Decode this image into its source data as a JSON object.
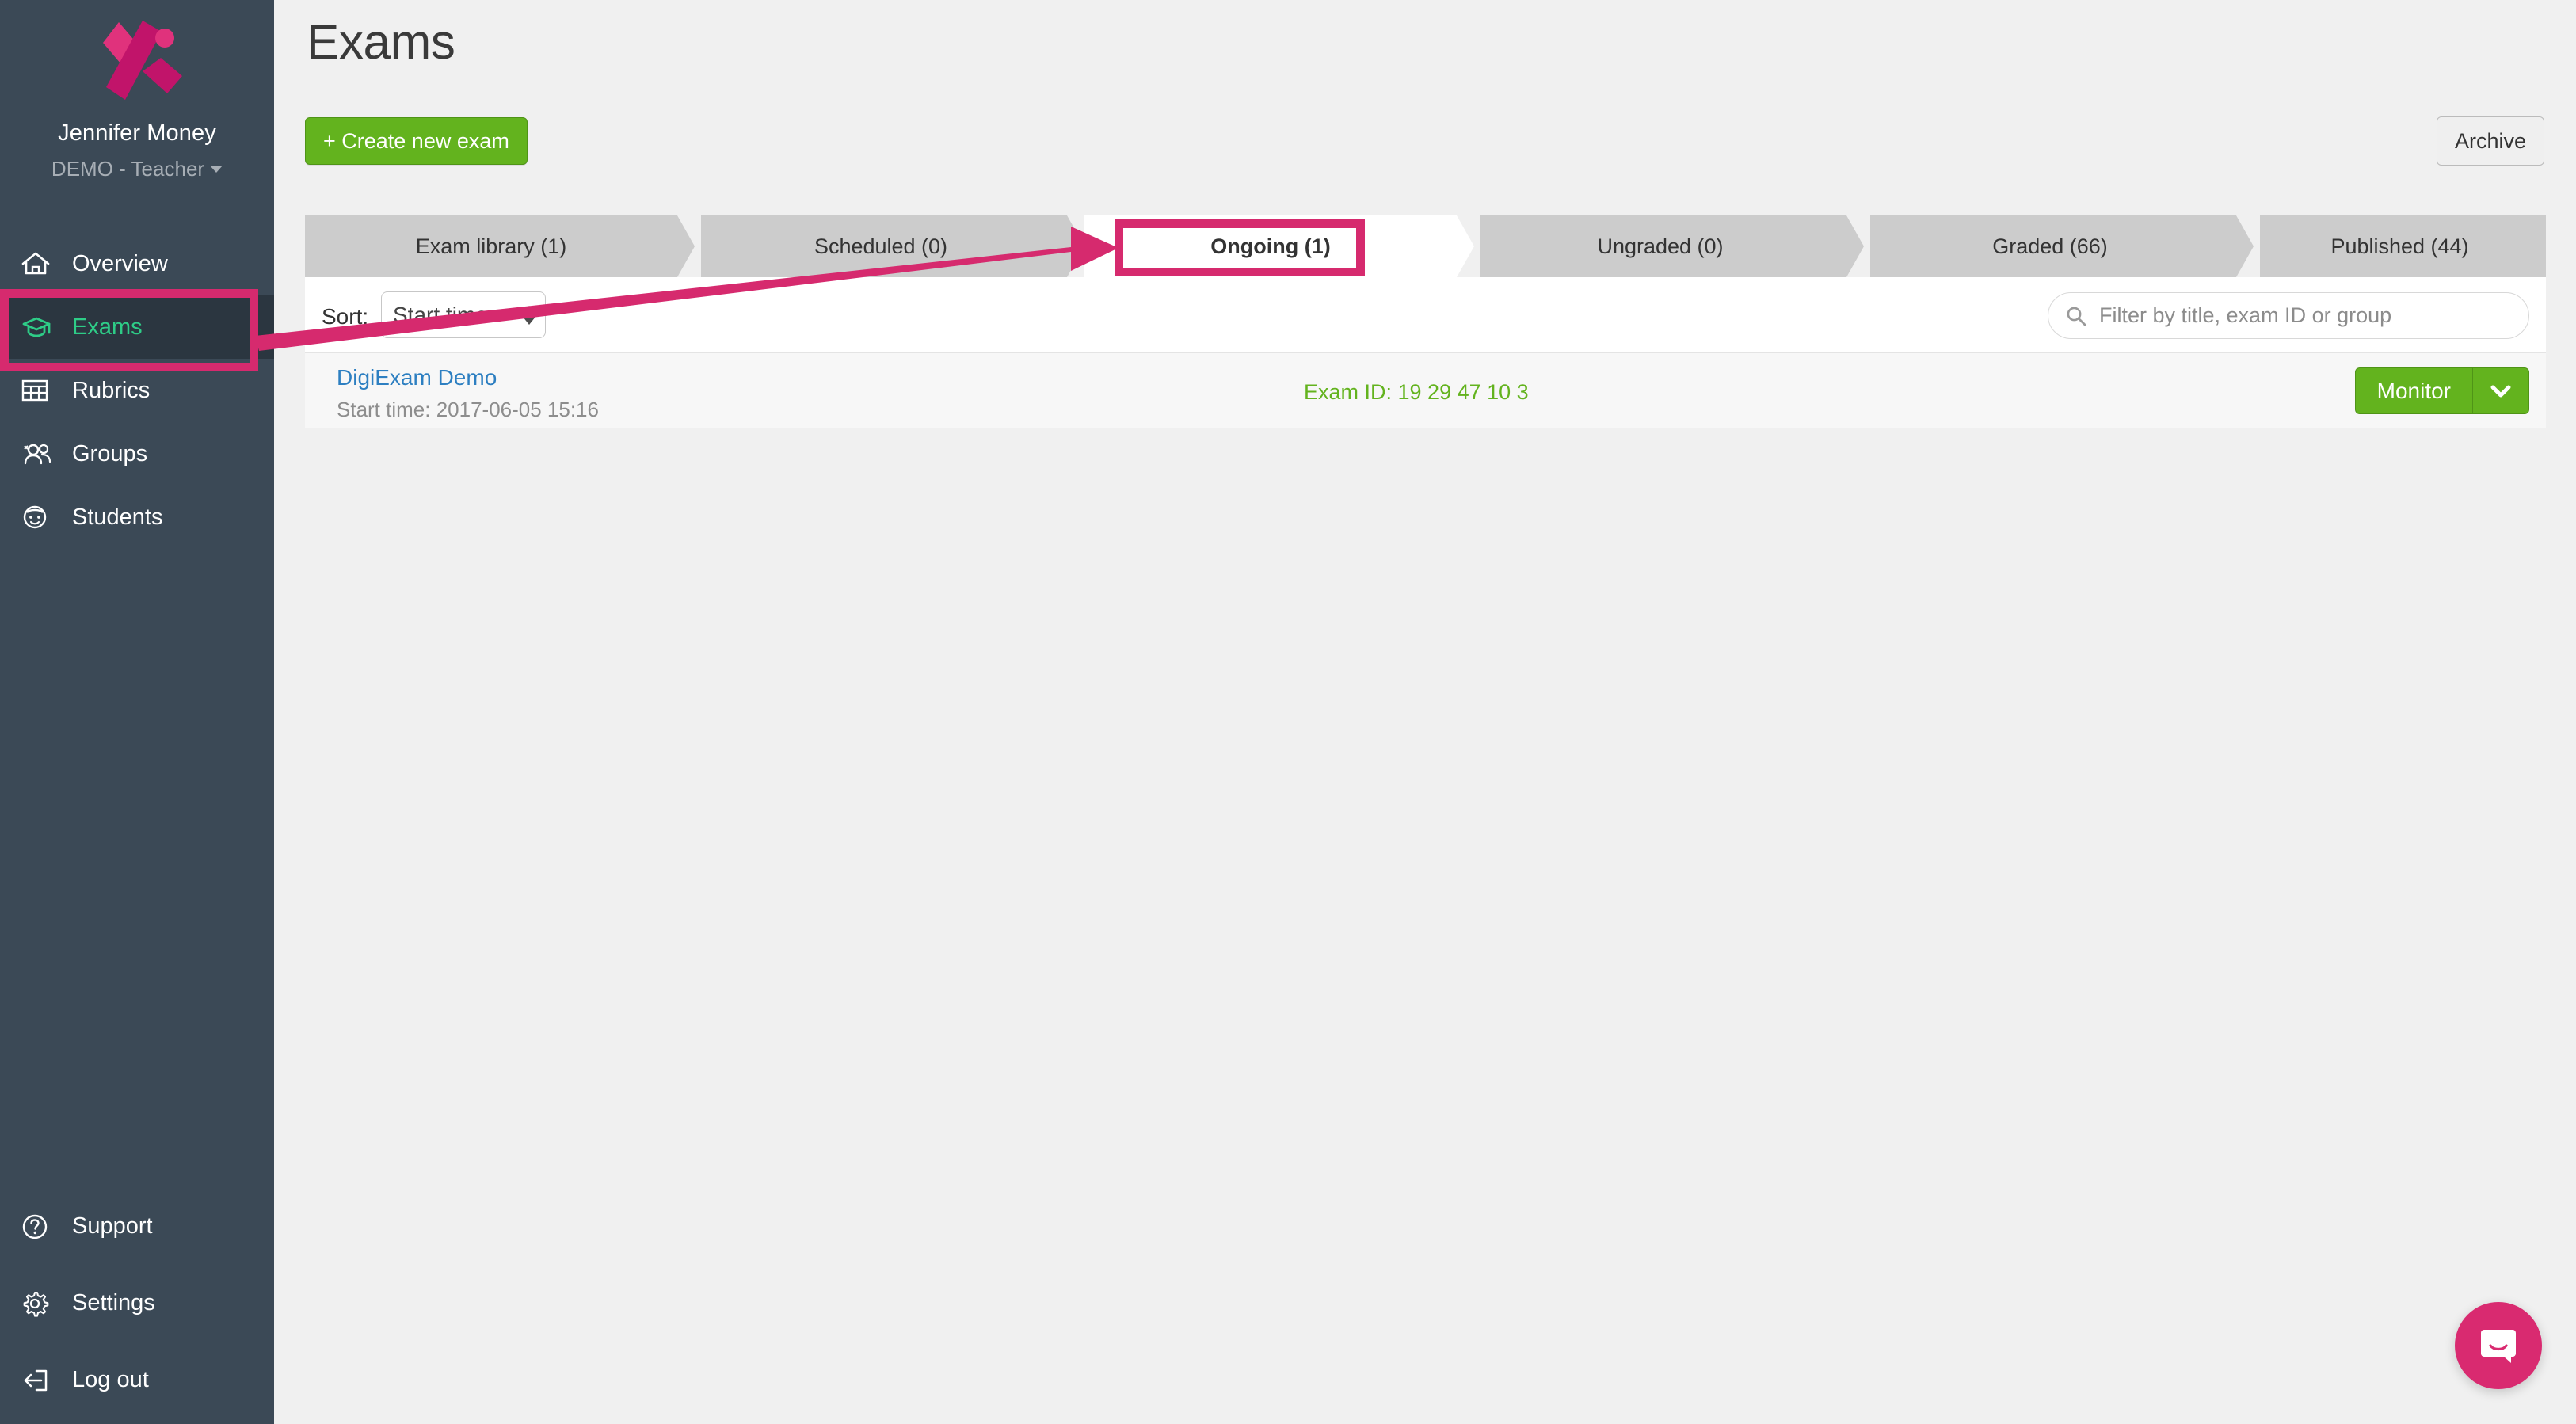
{
  "sidebar": {
    "logo_icon": "digiexam-x-logo",
    "user_name": "Jennifer Money",
    "user_role": "DEMO - Teacher",
    "items": [
      {
        "label": "Overview",
        "icon": "home-icon",
        "active": false
      },
      {
        "label": "Exams",
        "icon": "graduation-cap-icon",
        "active": true
      },
      {
        "label": "Rubrics",
        "icon": "table-grid-icon",
        "active": false
      },
      {
        "label": "Groups",
        "icon": "users-icon",
        "active": false
      },
      {
        "label": "Students",
        "icon": "student-face-icon",
        "active": false
      }
    ],
    "bottom_items": [
      {
        "label": "Support",
        "icon": "question-circle-icon"
      },
      {
        "label": "Settings",
        "icon": "gear-icon"
      },
      {
        "label": "Log out",
        "icon": "logout-arrow-icon"
      }
    ]
  },
  "header": {
    "title": "Exams",
    "create_button": "+ Create new exam",
    "archive_button": "Archive"
  },
  "tabs": [
    {
      "label": "Exam library (1)",
      "active": false
    },
    {
      "label": "Scheduled (0)",
      "active": false
    },
    {
      "label": "Ongoing (1)",
      "active": true
    },
    {
      "label": "Ungraded (0)",
      "active": false
    },
    {
      "label": "Graded (66)",
      "active": false
    },
    {
      "label": "Published (44)",
      "active": false
    }
  ],
  "toolbar": {
    "sort_label": "Sort:",
    "sort_value": "Start time",
    "sort_options": [
      "Start time"
    ],
    "filter_placeholder": "Filter by title, exam ID or group",
    "filter_value": "",
    "search_icon": "search-icon"
  },
  "exam_rows": [
    {
      "title": "DigiExam Demo",
      "start_time": "Start time: 2017-06-05 15:16",
      "exam_id": "Exam ID: 19 29 47 10 3",
      "action_label": "Monitor",
      "action_caret_icon": "chevron-down-icon"
    }
  ],
  "chat": {
    "icon": "chat-bubble-icon"
  },
  "colors": {
    "sidebar_bg": "#3b4956",
    "sidebar_active_bg": "#2b3640",
    "accent_green": "#63b31e",
    "active_nav_green": "#2ecc87",
    "brand_pink": "#d62a6e",
    "link_blue": "#2d7fc1",
    "tab_inactive_bg": "#cccccc",
    "page_bg": "#f0f0f0",
    "row_bg": "#f7f7f7"
  },
  "annotations": {
    "sidebar_highlight": "exams-sidebar-item",
    "tab_highlight": "ongoing-tab",
    "arrow": "pink-arrow-pointing-to-ongoing-tab"
  }
}
